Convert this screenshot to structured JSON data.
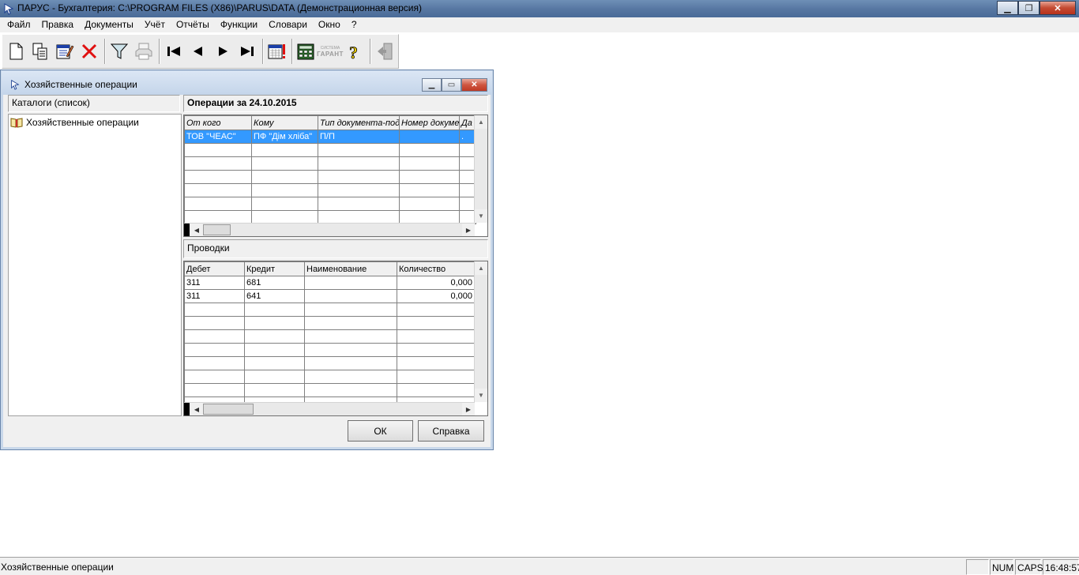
{
  "app": {
    "title": "ПАРУС - Бухгалтерия: C:\\PROGRAM FILES (X86)\\PARUS\\DATA (Демонстрационная версия)"
  },
  "menu": [
    "Файл",
    "Правка",
    "Документы",
    "Учёт",
    "Отчёты",
    "Функции",
    "Словари",
    "Окно",
    "?"
  ],
  "toolbar": {
    "icons": [
      "new-document-icon",
      "copy-icon",
      "edit-icon",
      "delete-icon",
      "filter-icon",
      "print-icon",
      "first-record-icon",
      "previous-record-icon",
      "next-record-icon",
      "last-record-icon",
      "calendar-icon",
      "calculator-icon",
      "garant-system-icon",
      "help-icon",
      "exit-icon"
    ],
    "garant_label_top": "СИСТЕМА",
    "garant_label_bottom": "ГАРАНТ"
  },
  "dialog": {
    "title": "Хозяйственные операции",
    "catalog_header": "Каталоги (список)",
    "catalog_item": "Хозяйственные операции",
    "operations_header": "Операции за 24.10.2015",
    "operations_columns": [
      "От кого",
      "Кому",
      "Тип документа-под",
      "Номер докуме",
      "Да"
    ],
    "operations_rows": [
      [
        "ТОВ \"ЧЕАС\"",
        "ПФ \"Дім хліба\"",
        "П/П",
        "",
        "."
      ]
    ],
    "postings_header": "Проводки",
    "postings_columns": [
      "Дебет",
      "Кредит",
      "Наименование",
      "Количество"
    ],
    "postings_rows": [
      [
        "311",
        "681",
        "",
        "0,000"
      ],
      [
        "311",
        "641",
        "",
        "0,000"
      ]
    ],
    "ok_label": "ОК",
    "help_label": "Справка"
  },
  "statusbar": {
    "text": "Хозяйственные операции",
    "num": "NUM",
    "caps": "CAPS",
    "time": "16:48:57"
  }
}
